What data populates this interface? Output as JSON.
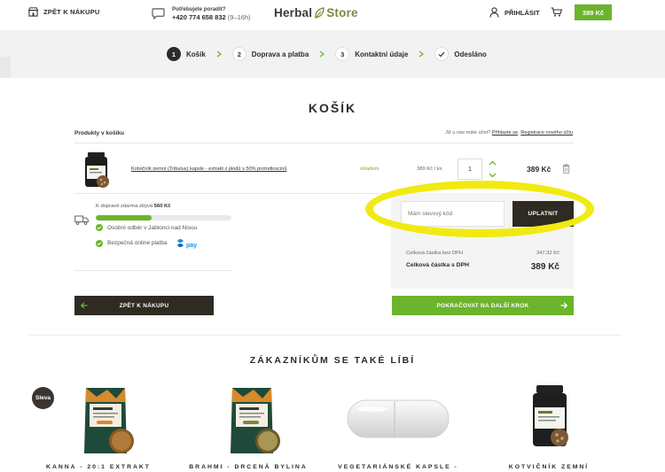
{
  "header": {
    "back_label": "ZPĚT K NÁKUPU",
    "help_question": "Potřebujete poradit?",
    "phone": "+420 774 658 832",
    "phone_hours": "(9–16h)",
    "logo_part1": "Herbal",
    "logo_part2": "Store",
    "login_label": "PŘIHLÁSIT",
    "cart_total": "389 Kč"
  },
  "steps": [
    {
      "num": "1",
      "label": "Košík",
      "active": true
    },
    {
      "num": "2",
      "label": "Doprava a platba"
    },
    {
      "num": "3",
      "label": "Kontaktní údaje"
    },
    {
      "label": "Odesláno"
    }
  ],
  "cart": {
    "title": "KOŠÍK",
    "products_heading": "Produkty v košíku",
    "account_text": "Již u nás máte účet?",
    "login_link": "Přihlaste se",
    "separator": ".",
    "register_link": "Registrace nového účtu",
    "item": {
      "name": "Kotvičník zemní (Tribulus) kapsle - extrakt z plodů s 50% protodioscinů",
      "stock": "skladem",
      "unit_price": "389 Kč / ks",
      "quantity": "1",
      "total": "389 Kč"
    },
    "shipping": {
      "free_text": "K dopravě zdarma zbývá",
      "remaining": "560 Kč",
      "progress_percent": 41,
      "benefits": [
        "Osobní odběr v Jablonci nad Nisou",
        "Bezpečná online platba"
      ],
      "gopay_label": "pay"
    },
    "coupon": {
      "placeholder": "Mám slevový kód",
      "button_label": "UPLATNIT"
    },
    "summary": {
      "net_label": "Celková částka bez DPH",
      "net_value": "347,32 Kč",
      "gross_label": "Celková částka s DPH",
      "gross_value": "389 Kč"
    },
    "back_button": "ZPĚT K NÁKUPU",
    "next_button": "POKRAČOVAT NA DALŠÍ KROK"
  },
  "recommendations": {
    "title": "ZÁKAZNÍKŮM SE TAKÉ LÍBÍ",
    "sale_badge": "Sleva",
    "items": [
      {
        "name": "KANNA - 20:1 EXTRAKT"
      },
      {
        "name": "BRAHMI - DRCENÁ BYLINA"
      },
      {
        "name": "VEGETARIÁNSKÉ KAPSLE -"
      },
      {
        "name": "KOTVIČNÍK ZEMNÍ"
      }
    ]
  },
  "colors": {
    "accent_green": "#6cb42c",
    "dark": "#2f2a22",
    "highlight": "#f1ea12"
  }
}
